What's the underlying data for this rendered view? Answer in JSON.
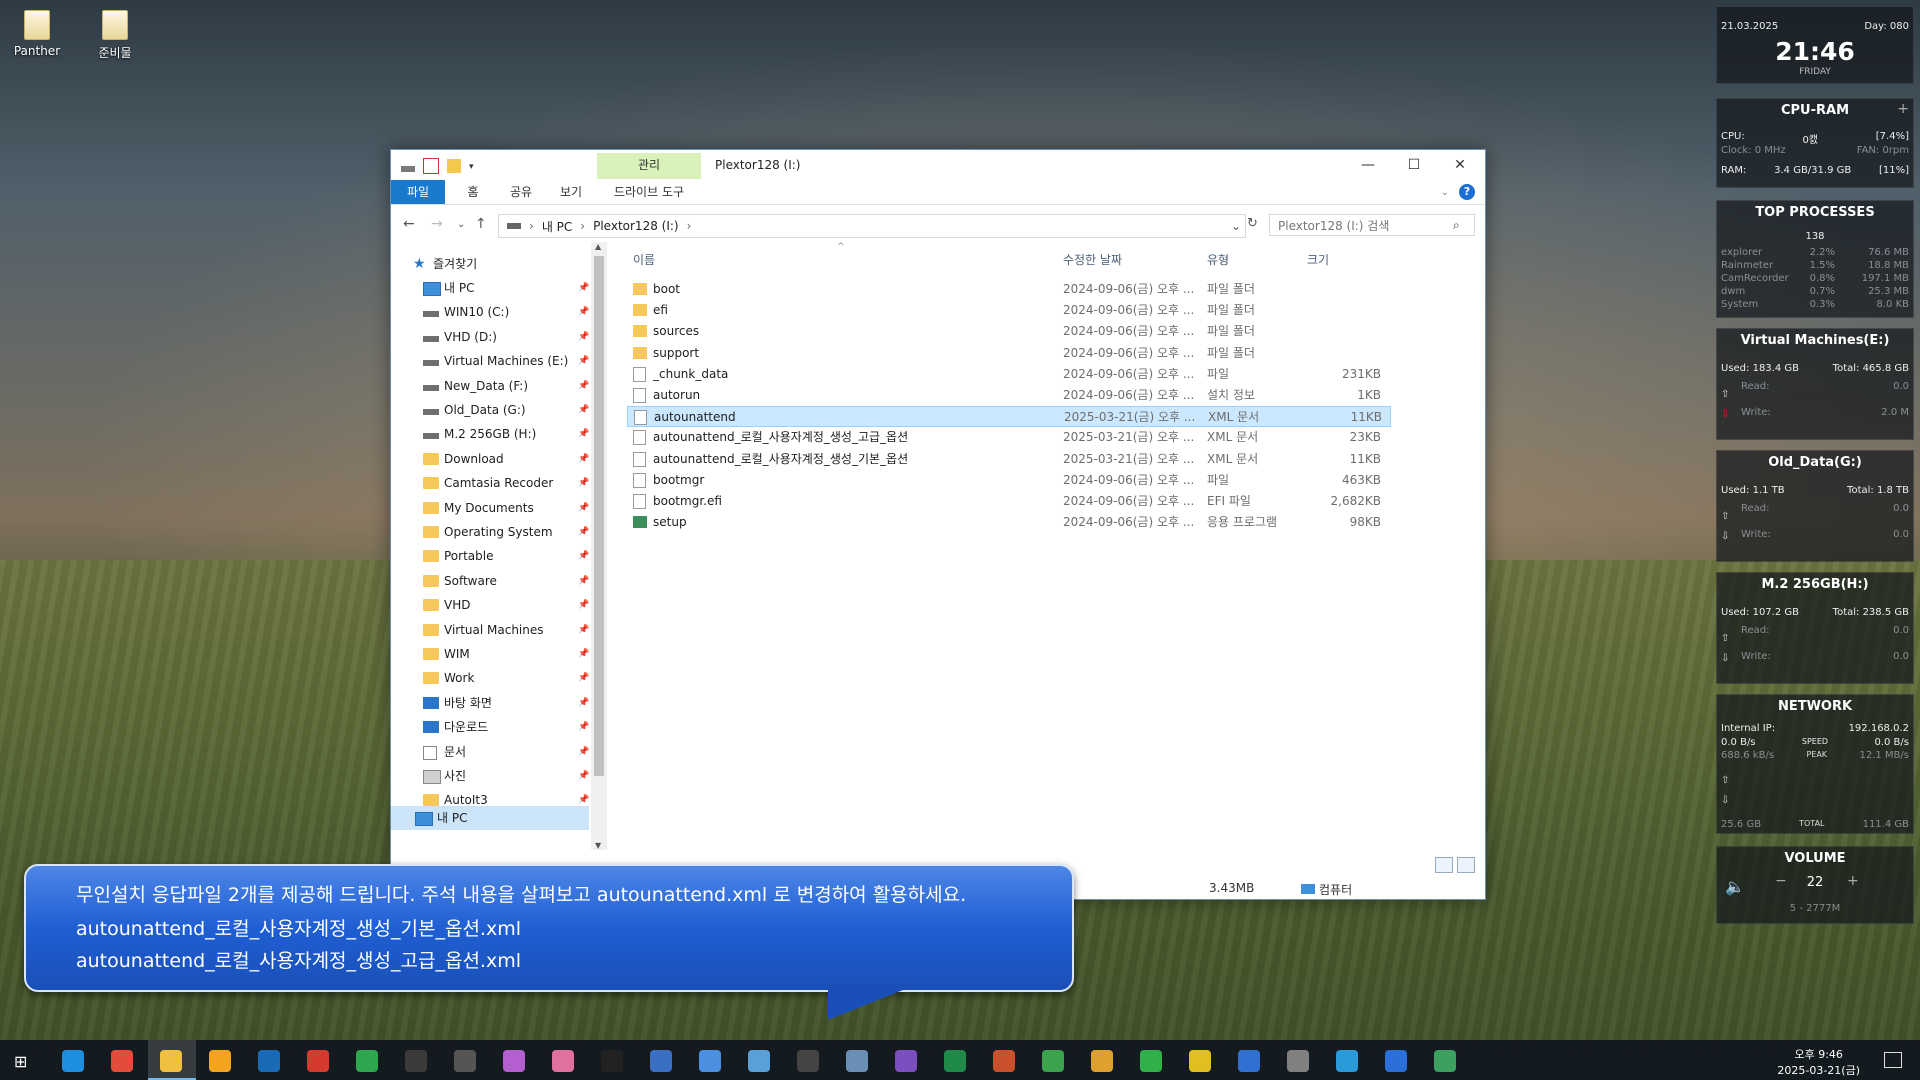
{
  "desktop": {
    "icons": [
      {
        "label": "Panther"
      },
      {
        "label": "준비물"
      }
    ]
  },
  "window": {
    "title": "Plextor128 (I:)",
    "context_tab": "관리",
    "tabs": {
      "file": "파일",
      "home": "홈",
      "share": "공유",
      "view": "보기",
      "drive_tools": "드라이브 도구"
    },
    "address": {
      "root": "내 PC",
      "drive": "Plextor128 (I:)"
    },
    "search_placeholder": "Plextor128 (I:) 검색",
    "nav": {
      "quick_access": "즐겨찾기",
      "items": [
        "내 PC",
        "WIN10 (C:)",
        "VHD (D:)",
        "Virtual Machines (E:)",
        "New_Data (F:)",
        "Old_Data (G:)",
        "M.2 256GB (H:)",
        "Download",
        "Camtasia Recoder",
        "My Documents",
        "Operating System",
        "Portable",
        "Software",
        "VHD",
        "Virtual Machines",
        "WIM",
        "Work",
        "바탕 화면",
        "다운로드",
        "문서",
        "사진",
        "AutoIt3"
      ],
      "this_pc": "내 PC"
    },
    "columns": {
      "name": "이름",
      "date": "수정한 날짜",
      "type": "유형",
      "size": "크기"
    },
    "files": [
      {
        "name": "boot",
        "date": "2024-09-06(금) 오후 ...",
        "type": "파일 폴더",
        "size": ""
      },
      {
        "name": "efi",
        "date": "2024-09-06(금) 오후 ...",
        "type": "파일 폴더",
        "size": ""
      },
      {
        "name": "sources",
        "date": "2024-09-06(금) 오후 ...",
        "type": "파일 폴더",
        "size": ""
      },
      {
        "name": "support",
        "date": "2024-09-06(금) 오후 ...",
        "type": "파일 폴더",
        "size": ""
      },
      {
        "name": "_chunk_data",
        "date": "2024-09-06(금) 오후 ...",
        "type": "파일",
        "size": "231KB"
      },
      {
        "name": "autorun",
        "date": "2024-09-06(금) 오후 ...",
        "type": "설치 정보",
        "size": "1KB"
      },
      {
        "name": "autounattend",
        "date": "2025-03-21(금) 오후 ...",
        "type": "XML 문서",
        "size": "11KB"
      },
      {
        "name": "autounattend_로컬_사용자계정_생성_고급_옵션",
        "date": "2025-03-21(금) 오후 ...",
        "type": "XML 문서",
        "size": "23KB"
      },
      {
        "name": "autounattend_로컬_사용자계정_생성_기본_옵션",
        "date": "2025-03-21(금) 오후 ...",
        "type": "XML 문서",
        "size": "11KB"
      },
      {
        "name": "bootmgr",
        "date": "2024-09-06(금) 오후 ...",
        "type": "파일",
        "size": "463KB"
      },
      {
        "name": "bootmgr.efi",
        "date": "2024-09-06(금) 오후 ...",
        "type": "EFI 파일",
        "size": "2,682KB"
      },
      {
        "name": "setup",
        "date": "2024-09-06(금) 오후 ...",
        "type": "응용 프로그램",
        "size": "98KB"
      }
    ],
    "status": {
      "selected_size": "3.43MB",
      "location": "컴퓨터"
    }
  },
  "callout": {
    "line1": "무인설치 응답파일 2개를 제공해 드립니다. 주석 내용을 살펴보고 autounattend.xml 로 변경하여 활용하세요.",
    "line2": "autounattend_로컬_사용자계정_생성_기본_옵션.xml",
    "line3": "autounattend_로컬_사용자계정_생성_고급_옵션.xml"
  },
  "widgets": {
    "clock": {
      "date": "21.03.2025",
      "day": "Day: 080",
      "time": "21:46",
      "weekday": "FRIDAY"
    },
    "cpu_ram": {
      "title": "CPU-RAM",
      "cpu_label": "CPU:",
      "cpu_temp": "0캜",
      "cpu_pct": "[7.4%]",
      "clock": "Clock: 0 MHz",
      "fan": "FAN: 0rpm",
      "ram_label": "RAM:",
      "ram": "3.4 GB/31.9 GB",
      "ram_pct": "[11%]"
    },
    "top": {
      "title": "TOP PROCESSES",
      "count": "138",
      "rows": [
        [
          "explorer",
          "2.2%",
          "76.6 MB"
        ],
        [
          "Rainmeter",
          "1.5%",
          "18.8 MB"
        ],
        [
          "CamRecorder",
          "0.8%",
          "197.1 MB"
        ],
        [
          "dwm",
          "0.7%",
          "25.3 MB"
        ],
        [
          "System",
          "0.3%",
          "8.0 KB"
        ]
      ]
    },
    "vm": {
      "title": "Virtual Machines(E:)",
      "used": "Used: 183.4 GB",
      "total": "Total: 465.8 GB",
      "read": "Read:",
      "write": "Write:",
      "r": "0.0",
      "w": "2.0 M"
    },
    "old": {
      "title": "Old_Data(G:)",
      "used": "Used: 1.1 TB",
      "total": "Total: 1.8 TB",
      "read": "Read:",
      "write": "Write:",
      "r": "0.0",
      "w": "0.0"
    },
    "m2": {
      "title": "M.2 256GB(H:)",
      "used": "Used: 107.2 GB",
      "total": "Total: 238.5 GB",
      "read": "Read:",
      "write": "Write:",
      "r": "0.0",
      "w": "0.0"
    },
    "net": {
      "title": "NETWORK",
      "ip_label": "Internal IP:",
      "ip": "192.168.0.2",
      "down": "0.0 B/s",
      "speed": "SPEED",
      "up": "0.0 B/s",
      "down2": "688.6 kB/s",
      "peak": "PEAK",
      "up2": "12.1 MB/s",
      "tot1": "25.6 GB",
      "total": "TOTAL",
      "tot2": "111.4 GB"
    },
    "volume": {
      "title": "VOLUME",
      "level": "22",
      "device": "5 - 2777M"
    }
  },
  "taskbar": {
    "time": "오후 9:46",
    "date": "2025-03-21(금)"
  }
}
